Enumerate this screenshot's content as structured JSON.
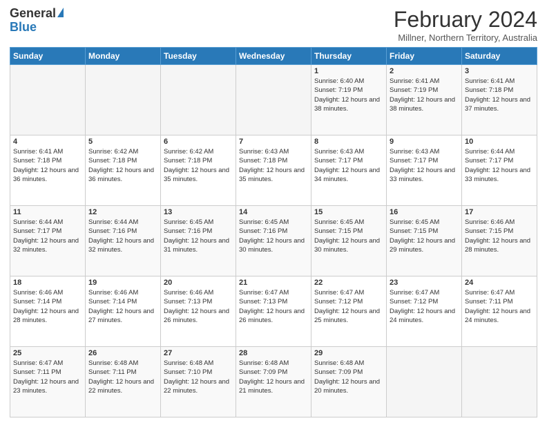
{
  "logo": {
    "general": "General",
    "blue": "Blue"
  },
  "title": "February 2024",
  "location": "Millner, Northern Territory, Australia",
  "days_of_week": [
    "Sunday",
    "Monday",
    "Tuesday",
    "Wednesday",
    "Thursday",
    "Friday",
    "Saturday"
  ],
  "weeks": [
    [
      {
        "day": "",
        "info": ""
      },
      {
        "day": "",
        "info": ""
      },
      {
        "day": "",
        "info": ""
      },
      {
        "day": "",
        "info": ""
      },
      {
        "day": "1",
        "info": "Sunrise: 6:40 AM\nSunset: 7:19 PM\nDaylight: 12 hours and 38 minutes."
      },
      {
        "day": "2",
        "info": "Sunrise: 6:41 AM\nSunset: 7:19 PM\nDaylight: 12 hours and 38 minutes."
      },
      {
        "day": "3",
        "info": "Sunrise: 6:41 AM\nSunset: 7:18 PM\nDaylight: 12 hours and 37 minutes."
      }
    ],
    [
      {
        "day": "4",
        "info": "Sunrise: 6:41 AM\nSunset: 7:18 PM\nDaylight: 12 hours and 36 minutes."
      },
      {
        "day": "5",
        "info": "Sunrise: 6:42 AM\nSunset: 7:18 PM\nDaylight: 12 hours and 36 minutes."
      },
      {
        "day": "6",
        "info": "Sunrise: 6:42 AM\nSunset: 7:18 PM\nDaylight: 12 hours and 35 minutes."
      },
      {
        "day": "7",
        "info": "Sunrise: 6:43 AM\nSunset: 7:18 PM\nDaylight: 12 hours and 35 minutes."
      },
      {
        "day": "8",
        "info": "Sunrise: 6:43 AM\nSunset: 7:17 PM\nDaylight: 12 hours and 34 minutes."
      },
      {
        "day": "9",
        "info": "Sunrise: 6:43 AM\nSunset: 7:17 PM\nDaylight: 12 hours and 33 minutes."
      },
      {
        "day": "10",
        "info": "Sunrise: 6:44 AM\nSunset: 7:17 PM\nDaylight: 12 hours and 33 minutes."
      }
    ],
    [
      {
        "day": "11",
        "info": "Sunrise: 6:44 AM\nSunset: 7:17 PM\nDaylight: 12 hours and 32 minutes."
      },
      {
        "day": "12",
        "info": "Sunrise: 6:44 AM\nSunset: 7:16 PM\nDaylight: 12 hours and 32 minutes."
      },
      {
        "day": "13",
        "info": "Sunrise: 6:45 AM\nSunset: 7:16 PM\nDaylight: 12 hours and 31 minutes."
      },
      {
        "day": "14",
        "info": "Sunrise: 6:45 AM\nSunset: 7:16 PM\nDaylight: 12 hours and 30 minutes."
      },
      {
        "day": "15",
        "info": "Sunrise: 6:45 AM\nSunset: 7:15 PM\nDaylight: 12 hours and 30 minutes."
      },
      {
        "day": "16",
        "info": "Sunrise: 6:45 AM\nSunset: 7:15 PM\nDaylight: 12 hours and 29 minutes."
      },
      {
        "day": "17",
        "info": "Sunrise: 6:46 AM\nSunset: 7:15 PM\nDaylight: 12 hours and 28 minutes."
      }
    ],
    [
      {
        "day": "18",
        "info": "Sunrise: 6:46 AM\nSunset: 7:14 PM\nDaylight: 12 hours and 28 minutes."
      },
      {
        "day": "19",
        "info": "Sunrise: 6:46 AM\nSunset: 7:14 PM\nDaylight: 12 hours and 27 minutes."
      },
      {
        "day": "20",
        "info": "Sunrise: 6:46 AM\nSunset: 7:13 PM\nDaylight: 12 hours and 26 minutes."
      },
      {
        "day": "21",
        "info": "Sunrise: 6:47 AM\nSunset: 7:13 PM\nDaylight: 12 hours and 26 minutes."
      },
      {
        "day": "22",
        "info": "Sunrise: 6:47 AM\nSunset: 7:12 PM\nDaylight: 12 hours and 25 minutes."
      },
      {
        "day": "23",
        "info": "Sunrise: 6:47 AM\nSunset: 7:12 PM\nDaylight: 12 hours and 24 minutes."
      },
      {
        "day": "24",
        "info": "Sunrise: 6:47 AM\nSunset: 7:11 PM\nDaylight: 12 hours and 24 minutes."
      }
    ],
    [
      {
        "day": "25",
        "info": "Sunrise: 6:47 AM\nSunset: 7:11 PM\nDaylight: 12 hours and 23 minutes."
      },
      {
        "day": "26",
        "info": "Sunrise: 6:48 AM\nSunset: 7:11 PM\nDaylight: 12 hours and 22 minutes."
      },
      {
        "day": "27",
        "info": "Sunrise: 6:48 AM\nSunset: 7:10 PM\nDaylight: 12 hours and 22 minutes."
      },
      {
        "day": "28",
        "info": "Sunrise: 6:48 AM\nSunset: 7:09 PM\nDaylight: 12 hours and 21 minutes."
      },
      {
        "day": "29",
        "info": "Sunrise: 6:48 AM\nSunset: 7:09 PM\nDaylight: 12 hours and 20 minutes."
      },
      {
        "day": "",
        "info": ""
      },
      {
        "day": "",
        "info": ""
      }
    ]
  ]
}
